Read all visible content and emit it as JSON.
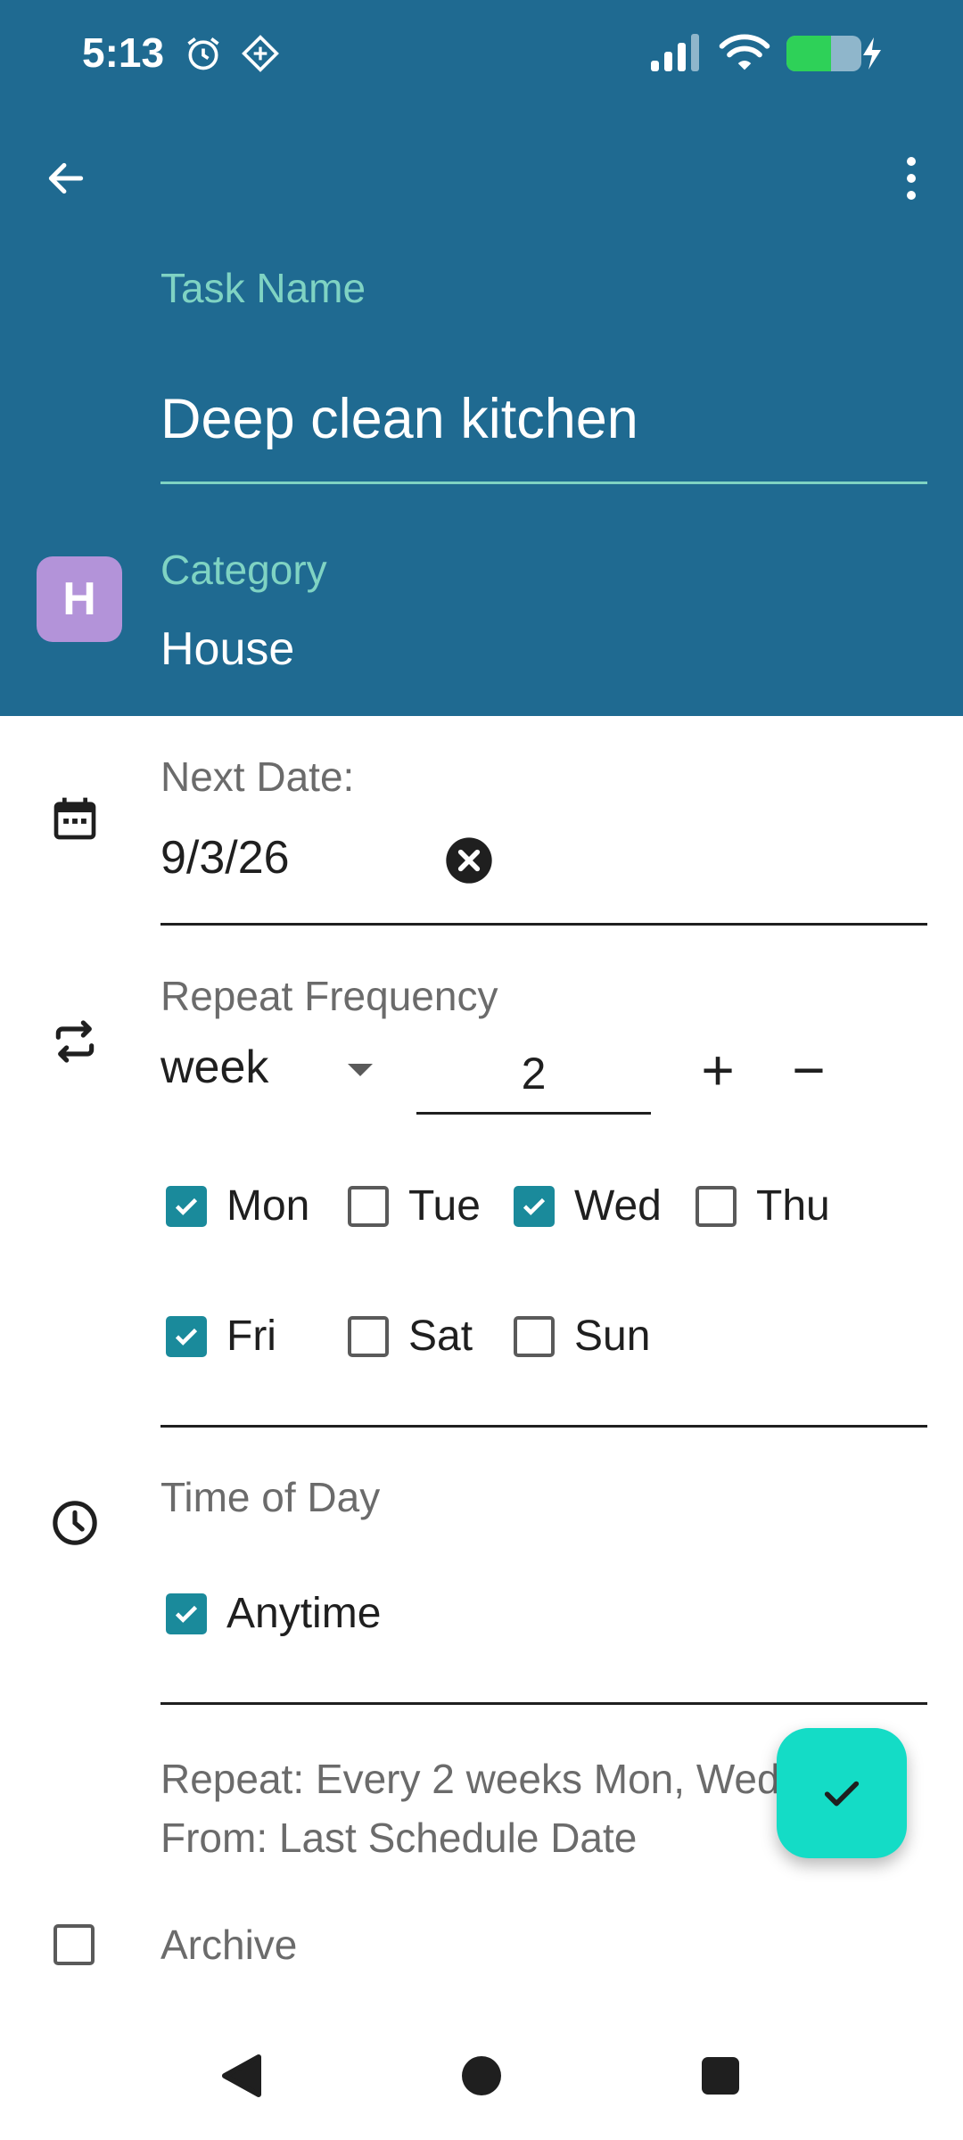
{
  "status_bar": {
    "time": "5:13",
    "icons": [
      "alarm-icon",
      "app-indicator-icon",
      "signal-icon",
      "wifi-icon",
      "battery-charging-icon"
    ]
  },
  "toolbar": {
    "back_icon": "arrow-left-icon",
    "menu_icon": "more-vertical-icon"
  },
  "task": {
    "label": "Task Name",
    "value": "Deep clean kitchen"
  },
  "category": {
    "label": "Category",
    "value": "House",
    "avatar_letter": "H",
    "avatar_color": "#b393d9"
  },
  "next_date": {
    "label": "Next Date:",
    "value": "9/3/26",
    "clear_icon": "clear-circle-icon"
  },
  "repeat": {
    "label": "Repeat Frequency",
    "unit": "week",
    "count": "2",
    "plus": "+",
    "minus": "−",
    "days": [
      {
        "label": "Mon",
        "checked": true
      },
      {
        "label": "Tue",
        "checked": false
      },
      {
        "label": "Wed",
        "checked": true
      },
      {
        "label": "Thu",
        "checked": false
      },
      {
        "label": "Fri",
        "checked": true
      },
      {
        "label": "Sat",
        "checked": false
      },
      {
        "label": "Sun",
        "checked": false
      }
    ]
  },
  "time_of_day": {
    "label": "Time of Day",
    "option": "Anytime",
    "checked": true
  },
  "summary": {
    "line1": "Repeat: Every 2 weeks Mon, Wed, Fri",
    "line2": "From: Last Schedule Date"
  },
  "archive": {
    "label": "Archive",
    "checked": false
  },
  "colors": {
    "header": "#1f6a91",
    "accent_label": "#7fd3c3",
    "checkbox": "#1a8a9b",
    "fab": "#14dcc6"
  }
}
